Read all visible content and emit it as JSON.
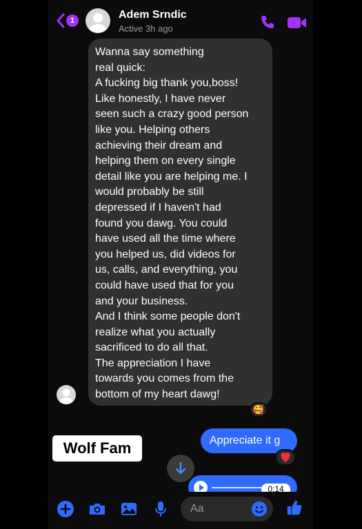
{
  "header": {
    "unread_count": "1",
    "contact_name": "Adem Srndic",
    "contact_status": "Active 3h ago",
    "icons": [
      "back-icon",
      "phone-icon",
      "video-camera-icon"
    ]
  },
  "messages": {
    "incoming": {
      "lines": [
        "Wanna say something",
        "real quick:",
        "A fucking big thank you,boss!",
        "Like honestly, I have never",
        "seen such a crazy good person",
        "like you. Helping others",
        "achieving their dream and",
        "helping them on every single",
        "detail like you are helping me. I",
        "would probably be still",
        "depressed if I haven't had",
        "found you dawg. You could",
        "have used all the time where",
        "you helped us, did videos for",
        "us, calls, and everything, you",
        "could have used that for you",
        "and your business.",
        "And I think some people don't",
        "realize what you actually",
        "sacrificed to do all that.",
        "The appreciation I have",
        "towards you comes from the",
        "bottom of my heart dawg!"
      ],
      "reaction": "🥰"
    },
    "outgoing": {
      "text": "Appreciate it g",
      "reaction": "heart"
    },
    "audio": {
      "duration": "0:14"
    }
  },
  "sticker": {
    "text": "Wolf Fam"
  },
  "composer": {
    "placeholder": "Aa",
    "icons": [
      "plus-icon",
      "camera-icon",
      "gallery-icon",
      "microphone-icon",
      "emoji-icon",
      "thumbs-up-icon"
    ]
  },
  "colors": {
    "accent": "#a033ff",
    "blue": "#2f6bff",
    "bubble_gray": "#303030",
    "background": "#0b0b0b"
  }
}
